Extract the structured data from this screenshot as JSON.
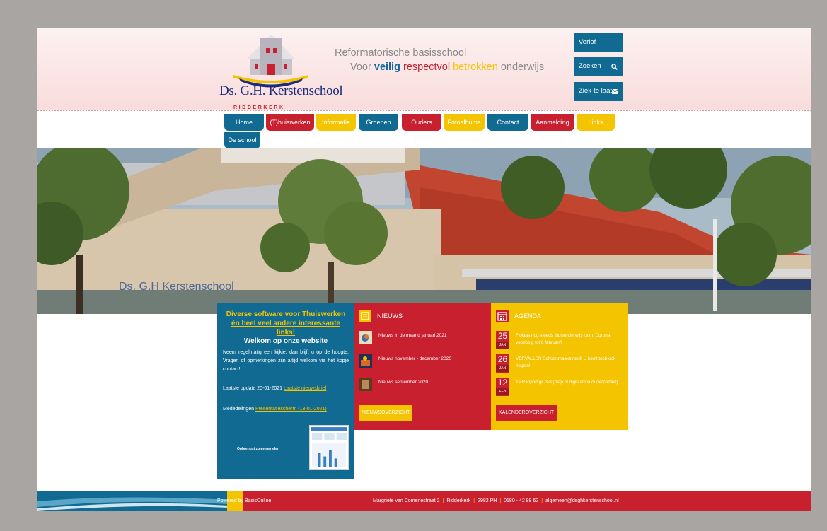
{
  "header": {
    "logo_name": "Ds. G.H. Kerstenschool",
    "logo_sub": "RIDDERKERK",
    "tagline_line1": "Reformatorische basisschool",
    "tagline_prefix": "Voor",
    "tagline_w1": "veilig",
    "tagline_w2": "respectvol",
    "tagline_w3": "betrokken",
    "tagline_suffix": "onderwijs",
    "buttons": [
      "Verlof",
      "Zoeken",
      "Ziek-te laat"
    ]
  },
  "nav": {
    "items": [
      "Home",
      "(T)huiswerken",
      "Informatie",
      "Groepen",
      "Ouders",
      "Fotoalbums",
      "Contact",
      "Aanmelding",
      "Links",
      "De school"
    ]
  },
  "hero": {
    "sign_text": "Ds. G.H Kerstenschool"
  },
  "welcome": {
    "promo_link": "Diverse software voor Thuiswerken én heel veel andere interessante links!",
    "title": "Welkom op onze website",
    "intro": "Neem regelmatig een kijkje, dan blijft u op de hoogte. Vragen of opmerkingen zijn altijd welkom via het kopje contact!",
    "update_label": "Laatste update 20-01-2021",
    "update_link": "Laatste nieuwsbrief",
    "med_label": "Mededelingen",
    "med_link": "Presentatiescherm (13-01-2021)",
    "thumb_caption": "Opbrengst zonnepanelen"
  },
  "news": {
    "title": "NIEUWS",
    "items": [
      "Nieuws in de maand januari 2021",
      "Nieuws november - december 2020",
      "Nieuws september 2020"
    ],
    "button": "NIEUWSOVERZICHT"
  },
  "agenda": {
    "title": "AGENDA",
    "events": [
      {
        "day": "25",
        "month": "JAN",
        "text": "Fiolaas nog steeds thuisonderwijs i.v.m. Corona, voorlopig tot 8 februari?"
      },
      {
        "day": "26",
        "month": "JAN",
        "text": "VERVALLEN Schoonmaakavond! U komt toch ook helpen!"
      },
      {
        "day": "12",
        "month": "FEB",
        "text": "1e Rapport gr. 3-8 (map of digitaal via ouderportaal)"
      }
    ],
    "button": "KALENDEROVERZICHT"
  },
  "footer": {
    "powered": "Powered by BasisOnline",
    "street": "Margriete van Comenestraat 2",
    "city": "Ridderkerk",
    "zip": "2982 PH",
    "phone": "0180 - 42 88 62",
    "email": "algemeen@dsghkerstenschool.nl"
  }
}
